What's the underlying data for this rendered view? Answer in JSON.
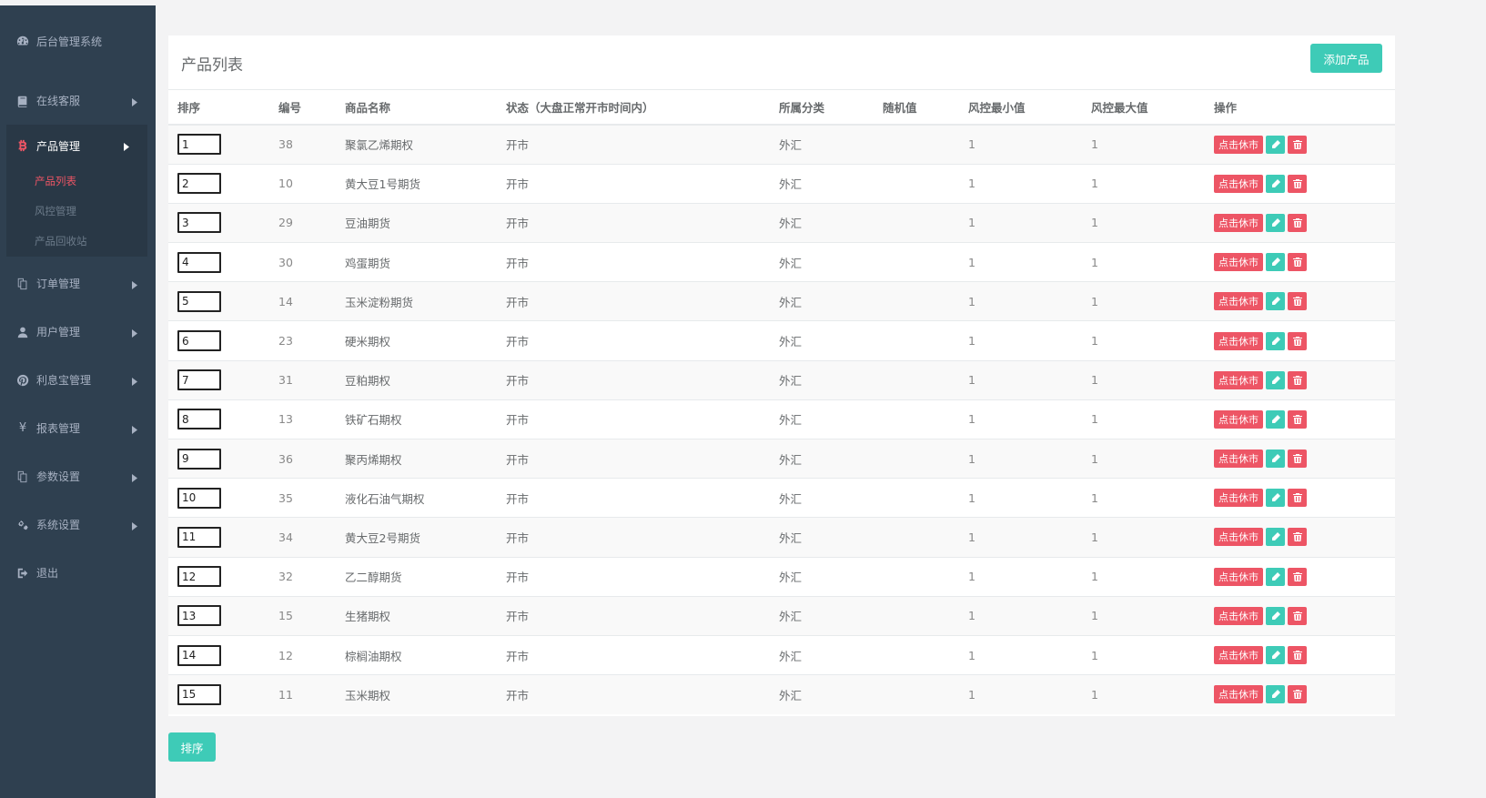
{
  "sidebar": {
    "brand": "后台管理系统",
    "items": [
      {
        "label": "在线客服",
        "icon": "book-icon"
      },
      {
        "label": "产品管理",
        "icon": "bitcoin-icon"
      },
      {
        "label": "订单管理",
        "icon": "copy-icon"
      },
      {
        "label": "用户管理",
        "icon": "user-icon"
      },
      {
        "label": "利息宝管理",
        "icon": "pinterest-icon"
      },
      {
        "label": "报表管理",
        "icon": "yen-icon"
      },
      {
        "label": "参数设置",
        "icon": "copy-icon"
      },
      {
        "label": "系统设置",
        "icon": "cogs-icon"
      },
      {
        "label": "退出",
        "icon": "sign-out-icon"
      }
    ],
    "sub_items": [
      "产品列表",
      "风控管理",
      "产品回收站"
    ]
  },
  "panel": {
    "title": "产品列表",
    "add_button": "添加产品"
  },
  "table": {
    "headers": [
      "排序",
      "编号",
      "商品名称",
      "状态（大盘正常开市时间内）",
      "所属分类",
      "随机值",
      "风控最小值",
      "风控最大值",
      "操作"
    ],
    "rest_label": "点击休市",
    "rows": [
      {
        "order": "1",
        "id": "38",
        "name": "聚氯乙烯期权",
        "status": "开市",
        "category": "外汇",
        "random": "",
        "min": "1",
        "max": "1"
      },
      {
        "order": "2",
        "id": "10",
        "name": "黄大豆1号期货",
        "status": "开市",
        "category": "外汇",
        "random": "",
        "min": "1",
        "max": "1"
      },
      {
        "order": "3",
        "id": "29",
        "name": "豆油期货",
        "status": "开市",
        "category": "外汇",
        "random": "",
        "min": "1",
        "max": "1"
      },
      {
        "order": "4",
        "id": "30",
        "name": "鸡蛋期货",
        "status": "开市",
        "category": "外汇",
        "random": "",
        "min": "1",
        "max": "1"
      },
      {
        "order": "5",
        "id": "14",
        "name": "玉米淀粉期货",
        "status": "开市",
        "category": "外汇",
        "random": "",
        "min": "1",
        "max": "1"
      },
      {
        "order": "6",
        "id": "23",
        "name": "硬米期权",
        "status": "开市",
        "category": "外汇",
        "random": "",
        "min": "1",
        "max": "1"
      },
      {
        "order": "7",
        "id": "31",
        "name": "豆粕期权",
        "status": "开市",
        "category": "外汇",
        "random": "",
        "min": "1",
        "max": "1"
      },
      {
        "order": "8",
        "id": "13",
        "name": "铁矿石期权",
        "status": "开市",
        "category": "外汇",
        "random": "",
        "min": "1",
        "max": "1"
      },
      {
        "order": "9",
        "id": "36",
        "name": "聚丙烯期权",
        "status": "开市",
        "category": "外汇",
        "random": "",
        "min": "1",
        "max": "1"
      },
      {
        "order": "10",
        "id": "35",
        "name": "液化石油气期权",
        "status": "开市",
        "category": "外汇",
        "random": "",
        "min": "1",
        "max": "1"
      },
      {
        "order": "11",
        "id": "34",
        "name": "黄大豆2号期货",
        "status": "开市",
        "category": "外汇",
        "random": "",
        "min": "1",
        "max": "1"
      },
      {
        "order": "12",
        "id": "32",
        "name": "乙二醇期货",
        "status": "开市",
        "category": "外汇",
        "random": "",
        "min": "1",
        "max": "1"
      },
      {
        "order": "13",
        "id": "15",
        "name": "生猪期权",
        "status": "开市",
        "category": "外汇",
        "random": "",
        "min": "1",
        "max": "1"
      },
      {
        "order": "14",
        "id": "12",
        "name": "棕榈油期权",
        "status": "开市",
        "category": "外汇",
        "random": "",
        "min": "1",
        "max": "1"
      },
      {
        "order": "15",
        "id": "11",
        "name": "玉米期权",
        "status": "开市",
        "category": "外汇",
        "random": "",
        "min": "1",
        "max": "1"
      }
    ]
  },
  "footer": {
    "sort_button": "排序"
  }
}
